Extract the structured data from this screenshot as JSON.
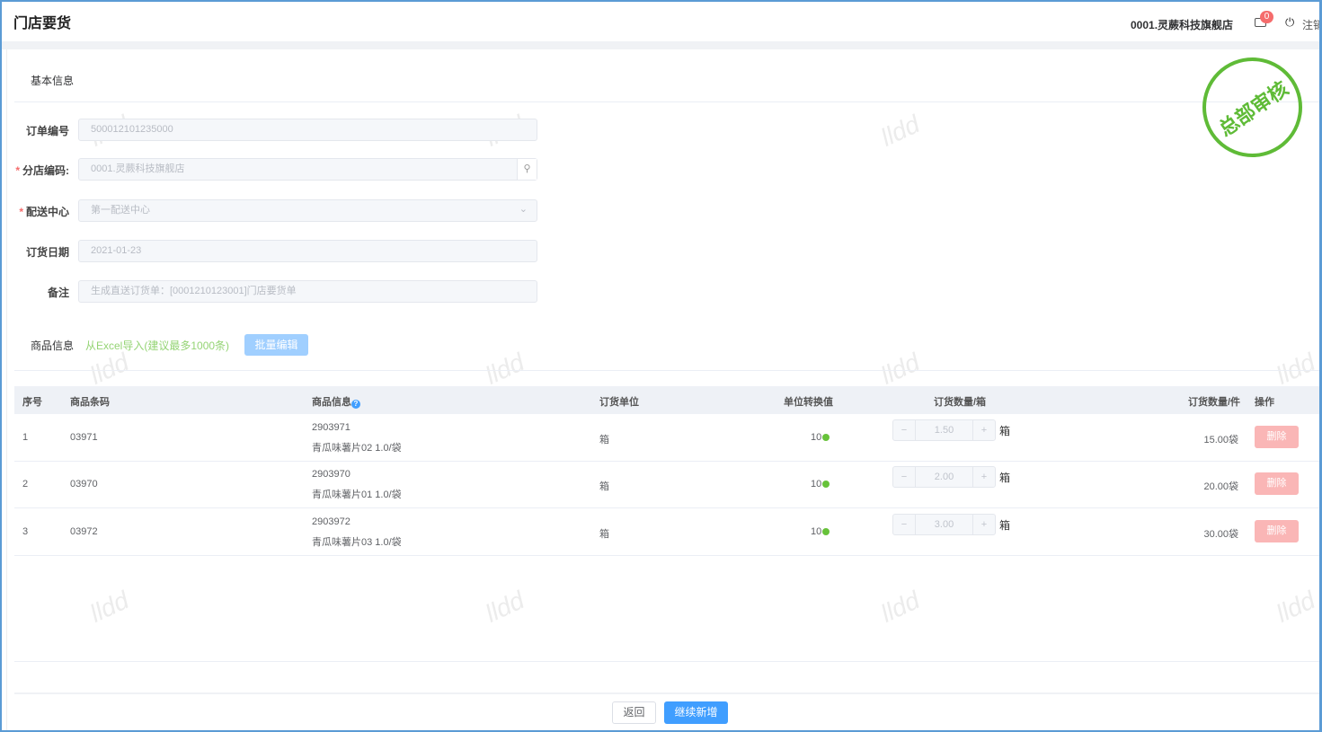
{
  "header": {
    "title": "门店要货",
    "store": "0001.灵蕨科技旗舰店",
    "mail_count": "0",
    "power_icon": "⏻",
    "logout": "注销"
  },
  "basic": {
    "section": "基本信息",
    "order_no": {
      "label": "订单编号",
      "value": "500012101235000"
    },
    "branch": {
      "label": "分店编码:",
      "value": "0001.灵蕨科技旗舰店"
    },
    "dc": {
      "label": "配送中心",
      "value": "第一配送中心"
    },
    "date": {
      "label": "订货日期",
      "value": "2021-01-23"
    },
    "remark": {
      "label": "备注",
      "value": "生成直送订货单：[0001210123001]门店要货单"
    },
    "required_mark": "*"
  },
  "stamp": "总部审核",
  "goods": {
    "section": "商品信息",
    "excel": "从Excel导入(建议最多1000条)",
    "batch": "批量编辑"
  },
  "table": {
    "headers": [
      "序号",
      "商品条码",
      "商品信息",
      "订货单位",
      "单位转换值",
      "订货数量/箱",
      "订货数量/件",
      "操作"
    ],
    "rows": [
      {
        "no": "1",
        "barcode": "03971",
        "code": "2903971",
        "name": "青瓜味薯片02 1.0/袋",
        "unit": "箱",
        "conv": "10",
        "qty_box": "1.50",
        "box": "箱",
        "qty_piece": "15.00袋",
        "action": "删除"
      },
      {
        "no": "2",
        "barcode": "03970",
        "code": "2903970",
        "name": "青瓜味薯片01 1.0/袋",
        "unit": "箱",
        "conv": "10",
        "qty_box": "2.00",
        "box": "箱",
        "qty_piece": "20.00袋",
        "action": "删除"
      },
      {
        "no": "3",
        "barcode": "03972",
        "code": "2903972",
        "name": "青瓜味薯片03 1.0/袋",
        "unit": "箱",
        "conv": "10",
        "qty_box": "3.00",
        "box": "箱",
        "qty_piece": "30.00袋",
        "action": "删除"
      }
    ]
  },
  "footer": {
    "back": "返回",
    "continue": "继续新增"
  },
  "watermark": "lldd",
  "stepper": {
    "minus": "−",
    "plus": "+"
  },
  "colors": {
    "primary": "#409eff",
    "danger": "#f56c6c",
    "success": "#67c23a"
  }
}
